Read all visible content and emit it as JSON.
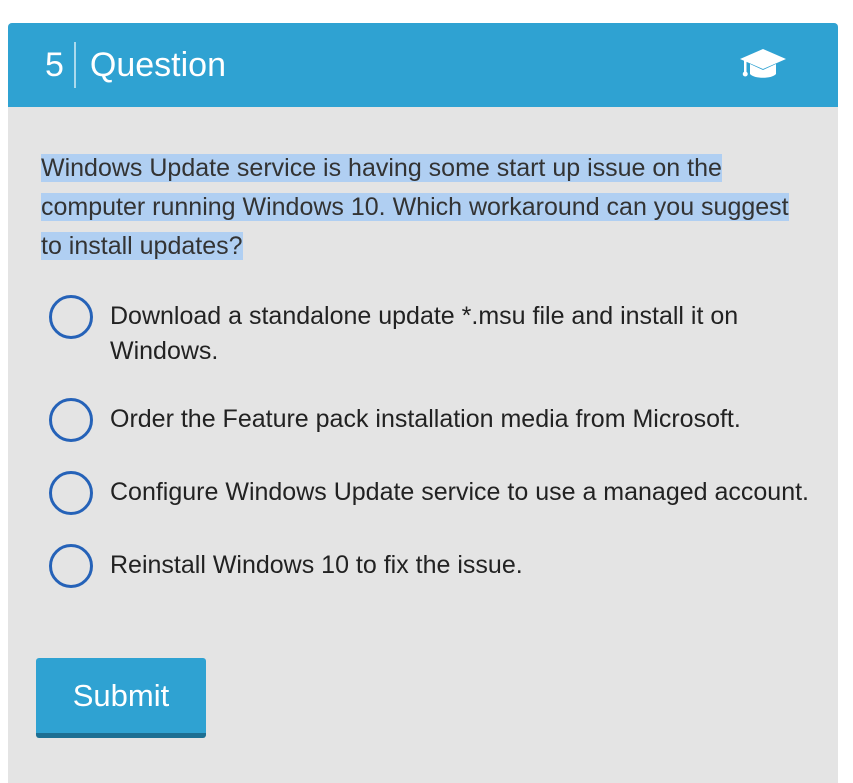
{
  "header": {
    "number": "5",
    "title": "Question",
    "icon": "graduation-cap-icon"
  },
  "question": {
    "text": "Windows Update service is having some start up issue on the computer running Windows 10. Which workaround can you suggest to install updates?"
  },
  "options": [
    {
      "label": "Download a standalone update *.msu file and install it on Windows."
    },
    {
      "label": "Order the Feature pack installation media from Microsoft."
    },
    {
      "label": "Configure Windows Update service to use a managed account."
    },
    {
      "label": "Reinstall Windows 10 to fix the issue."
    }
  ],
  "submit": {
    "label": "Submit"
  },
  "colors": {
    "header": "#2fa2d2",
    "panel": "#e4e4e4",
    "radio": "#2562b8",
    "highlight": "#b0cff2"
  }
}
